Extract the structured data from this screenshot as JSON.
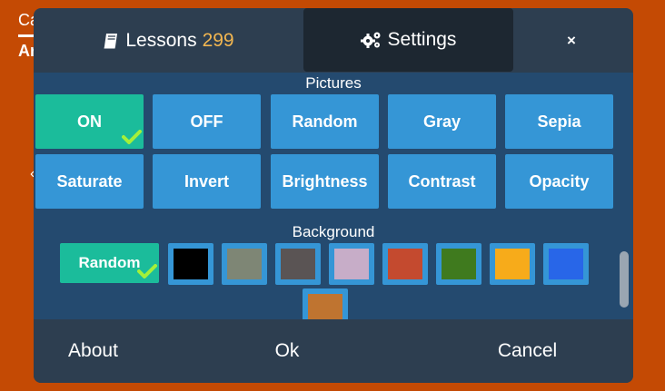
{
  "background_page": {
    "text_top": "Ca",
    "text_bottom": "Ar"
  },
  "tabs": {
    "lessons_label": "Lessons",
    "lessons_count": "299",
    "settings_label": "Settings",
    "close_label": "×"
  },
  "pictures": {
    "title": "Pictures",
    "options": [
      "ON",
      "OFF",
      "Random",
      "Gray",
      "Sepia",
      "Saturate",
      "Invert",
      "Brightness",
      "Contrast",
      "Opacity"
    ],
    "selected": "ON"
  },
  "background": {
    "title": "Background",
    "random_label": "Random",
    "selected": "Random",
    "swatches": [
      "#000000",
      "#7e8675",
      "#5a5454",
      "#c7adc8",
      "#c44a2f",
      "#3f7a1e",
      "#f7ab1a",
      "#2866e8",
      "#bf7430"
    ]
  },
  "footer": {
    "about_label": "About",
    "ok_label": "Ok",
    "cancel_label": "Cancel"
  },
  "colors": {
    "page_bg": "#c44a04",
    "modal_bg": "#2d3e50",
    "panel_bg": "#244a6f",
    "button_blue": "#3596d6",
    "button_active": "#1bbc9b",
    "count_color": "#f2b650",
    "check_color": "#a4f03a"
  }
}
